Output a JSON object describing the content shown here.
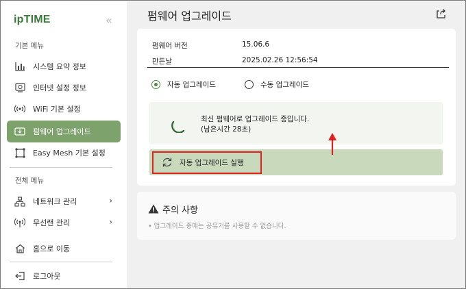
{
  "sidebar": {
    "logo": "ipTIME",
    "collapse_glyph": "«",
    "basic_menu_title": "기본 메뉴",
    "basic_items": [
      {
        "label": "시스템 요약 정보",
        "icon": "bar-chart-icon"
      },
      {
        "label": "인터넷 설정 정보",
        "icon": "globe-window-icon"
      },
      {
        "label": "WiFi 기본 설정",
        "icon": "wifi-signal-icon"
      },
      {
        "label": "펌웨어 업그레이드",
        "icon": "firmware-icon",
        "active": true
      },
      {
        "label": "Easy Mesh 기본 설정",
        "icon": "mesh-icon"
      }
    ],
    "full_menu_title": "전체 메뉴",
    "full_items": [
      {
        "label": "네트워크 관리",
        "icon": "network-icon",
        "chevron": "›"
      },
      {
        "label": "무선랜 관리",
        "icon": "wireless-icon",
        "chevron": "›"
      }
    ],
    "home_label": "홈으로 이동",
    "logout_label": "로그아웃"
  },
  "main": {
    "title": "펌웨어 업그레이드",
    "info": {
      "version_label": "펌웨어 버전",
      "version_value": "15.06.6",
      "date_label": "만든날",
      "date_value": "2025.02.26 12:56:54"
    },
    "options": {
      "auto_label": "자동 업그레이드",
      "manual_label": "수동 업그레이드",
      "selected": "auto"
    },
    "progress": {
      "line1": "최신 펌웨어로 업그레이드 중입니다.",
      "line2": "(남은시간 28초)"
    },
    "action_button_label": "자동 업그레이드 실행",
    "warning": {
      "title": "주의 사항",
      "note": "• 업그레이드 중에는 공유기를 사용할 수 없습니다."
    }
  },
  "colors": {
    "accent": "#7ea26b",
    "button_bg": "#c8d9bc",
    "highlight": "#e02020",
    "logo": "#3c7b3c"
  }
}
